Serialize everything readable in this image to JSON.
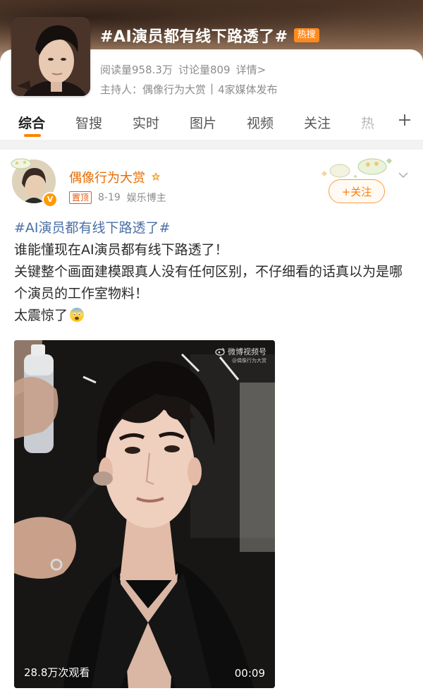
{
  "topic": {
    "title": "#AI演员都有线下路透了#",
    "badge": "热搜",
    "reads_label": "阅读量958.3万",
    "discussions_label": "讨论量809",
    "details_label": "详情>",
    "host_label": "主持人：偶像行为大赏",
    "separator": "|",
    "media_label": "4家媒体发布"
  },
  "tabs": [
    {
      "label": "综合",
      "active": true
    },
    {
      "label": "智搜"
    },
    {
      "label": "实时"
    },
    {
      "label": "图片"
    },
    {
      "label": "视频"
    },
    {
      "label": "关注"
    },
    {
      "label": "热"
    }
  ],
  "tabs_more_icon": "plus-icon",
  "post": {
    "author": "偶像行为大赏",
    "pin_tag": "置顶",
    "date": "8-19",
    "author_role": "娱乐博主",
    "follow_label": "+关注",
    "hashtag": "#AI演员都有线下路透了#",
    "lines": [
      "谁能懂现在AI演员都有线下路透了！",
      "关键整个画面建模跟真人没有任何区别，不仔细看的话真以为是哪个演员的工作室物料！",
      "太震惊了"
    ],
    "emoji": "fearful-face-emoji",
    "video": {
      "watermark": "微博视频号",
      "watermark_sub": "@偶像行为大赏",
      "play_count": "28.8万次观看",
      "duration": "00:09"
    }
  },
  "colors": {
    "accent": "#ff8200",
    "author_name": "#e86b00",
    "hashtag": "#4a6fa5",
    "hot_badge": "#ff8a1f"
  }
}
